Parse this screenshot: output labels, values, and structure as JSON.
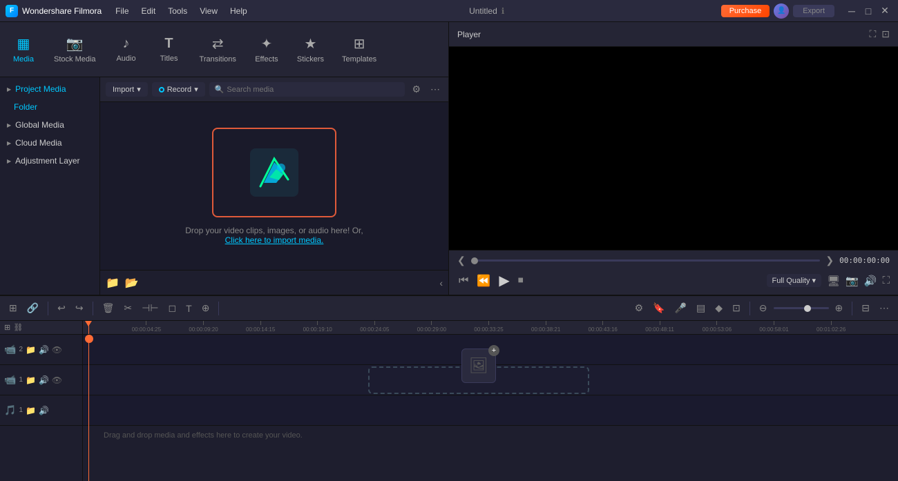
{
  "app": {
    "title": "Wondershare Filmora",
    "project_name": "Untitled"
  },
  "menu": {
    "items": [
      "File",
      "Edit",
      "Tools",
      "View",
      "Help"
    ]
  },
  "header": {
    "purchase_label": "Purchase",
    "export_label": "Export"
  },
  "media_tabs": [
    {
      "id": "media",
      "label": "Media",
      "icon": "▦",
      "active": true
    },
    {
      "id": "stock_media",
      "label": "Stock Media",
      "icon": "📷"
    },
    {
      "id": "audio",
      "label": "Audio",
      "icon": "♪"
    },
    {
      "id": "titles",
      "label": "Titles",
      "icon": "T"
    },
    {
      "id": "transitions",
      "label": "Transitions",
      "icon": "⟷"
    },
    {
      "id": "effects",
      "label": "Effects",
      "icon": "✦"
    },
    {
      "id": "stickers",
      "label": "Stickers",
      "icon": "★"
    },
    {
      "id": "templates",
      "label": "Templates",
      "icon": "⊞"
    }
  ],
  "sidebar": {
    "items": [
      {
        "id": "project_media",
        "label": "Project Media",
        "active": true,
        "indent": 0
      },
      {
        "id": "folder",
        "label": "Folder",
        "active": false,
        "indent": 1,
        "is_folder": true
      },
      {
        "id": "global_media",
        "label": "Global Media",
        "active": false,
        "indent": 0
      },
      {
        "id": "cloud_media",
        "label": "Cloud Media",
        "active": false,
        "indent": 0
      },
      {
        "id": "adjustment_layer",
        "label": "Adjustment Layer",
        "active": false,
        "indent": 0
      }
    ]
  },
  "media_toolbar": {
    "import_label": "Import",
    "record_label": "Record",
    "search_placeholder": "Search media"
  },
  "drop_zone": {
    "text": "Drop your video clips, images, or audio here! Or,",
    "link_text": "Click here to import media."
  },
  "player": {
    "title": "Player",
    "time_current": "00:00:00:00",
    "quality_label": "Full Quality"
  },
  "timeline": {
    "tracks": [
      {
        "id": "track2",
        "type": "video",
        "number": "2"
      },
      {
        "id": "track1",
        "type": "video",
        "number": "1"
      },
      {
        "id": "audio1",
        "type": "audio",
        "number": "1"
      }
    ],
    "ruler_marks": [
      "00:00:04:25",
      "00:00:09:20",
      "00:00:14:15",
      "00:00:19:10",
      "00:00:24:05",
      "00:00:29:00",
      "00:00:33:25",
      "00:00:38:21",
      "00:00:43:16",
      "00:00:48:11",
      "00:00:53:06",
      "00:00:58:01",
      "00:01:02:26"
    ],
    "drop_text": "Drag and drop media and effects here to create your video."
  }
}
